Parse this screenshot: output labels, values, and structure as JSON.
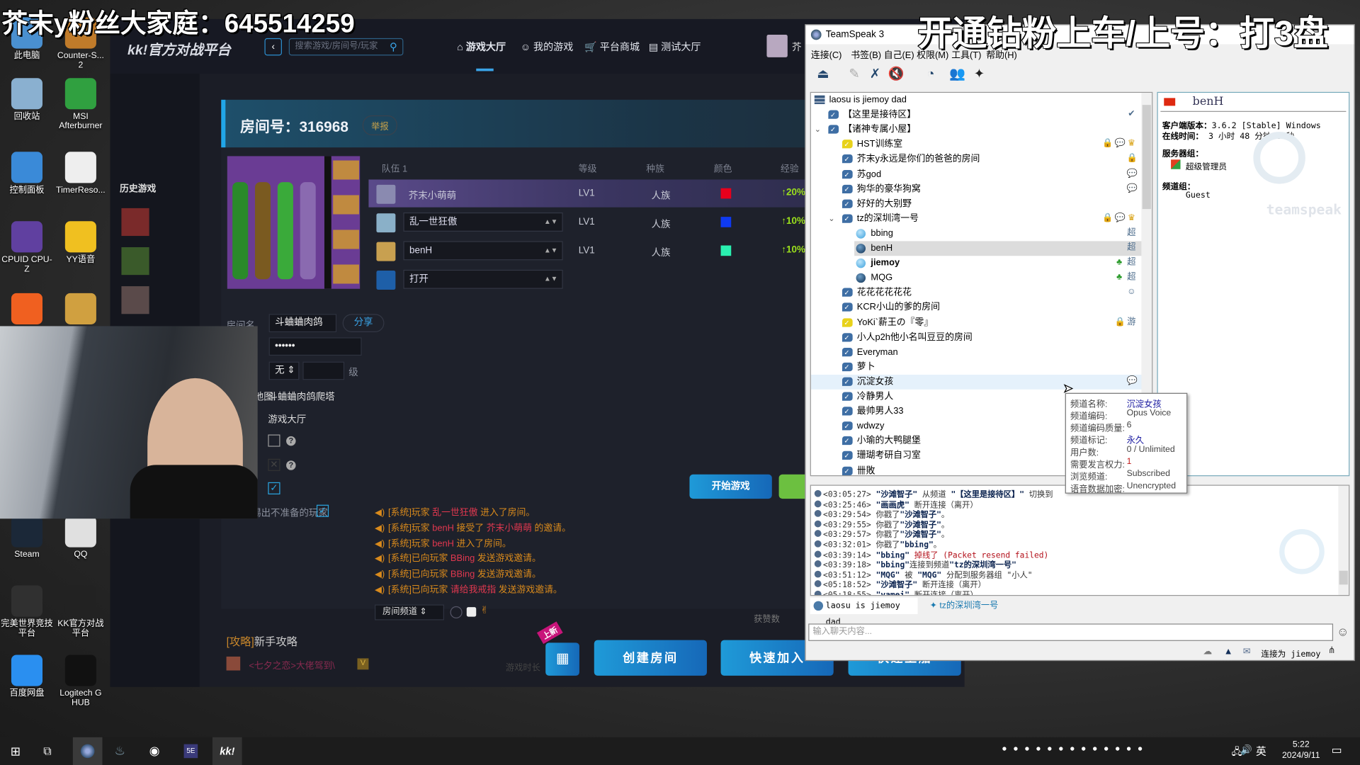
{
  "overlay": {
    "left_text": "芥末y粉丝大家庭：645514259",
    "right_text": "开通钻粉上车/上号：打3盘"
  },
  "desktop_icons": [
    {
      "label": "此电脑",
      "color": "#4a90d0"
    },
    {
      "label": "Counter-S... 2",
      "color": "#c07b2a"
    },
    {
      "label": "回收站",
      "color": "#8ab0d0"
    },
    {
      "label": "MSI Afterburner",
      "color": "#30a040"
    },
    {
      "label": "控制面板",
      "color": "#3a8ad8"
    },
    {
      "label": "TimerReso...",
      "color": "#eeeeee"
    },
    {
      "label": "CPUID CPU-Z",
      "color": "#6040a0"
    },
    {
      "label": "YY语音",
      "color": "#f0c020"
    },
    {
      "label": "",
      "color": "#f06020"
    },
    {
      "label": "",
      "color": "#d0a040"
    },
    {
      "label": "Steam",
      "color": "#1b2838"
    },
    {
      "label": "QQ",
      "color": "#e0e0e0"
    },
    {
      "label": "完美世界竞技平台",
      "color": "#303030"
    },
    {
      "label": "KK官方对战平台",
      "color": "#222222"
    },
    {
      "label": "百度网盘",
      "color": "#2a8ff0"
    },
    {
      "label": "Logitech G HUB",
      "color": "#111111"
    }
  ],
  "kk": {
    "logo": "kk!官方对战平台",
    "search_placeholder": "搜索游戏/房间号/玩家",
    "nav": [
      {
        "label": "游戏大厅",
        "active": true
      },
      {
        "label": "我的游戏"
      },
      {
        "label": "平台商城"
      },
      {
        "label": "测试大厅"
      }
    ],
    "user_name": "芥",
    "sidebar_title": "历史游戏",
    "room": {
      "title": "房间号：316968",
      "report": "举报",
      "team_header": "队伍 1",
      "col_level": "等级",
      "col_race": "种族",
      "col_color": "颜色",
      "col_exp": "经验",
      "players": [
        {
          "name": "芥末小萌萌",
          "level": "LV1",
          "race": "人族",
          "color": "#e8001c",
          "exp": "↑20%",
          "selected": true,
          "avatar": "#8a8ab0"
        },
        {
          "name": "乱一世狂傲",
          "level": "LV1",
          "race": "人族",
          "color": "#0f3af0",
          "exp": "↑10%",
          "avatar": "#8ab0c8"
        },
        {
          "name": "benH",
          "level": "LV1",
          "race": "人族",
          "color": "#2af0b0",
          "exp": "↑10%",
          "avatar": "#c8a050"
        },
        {
          "name": "打开",
          "avatar": "#1e5fa8"
        }
      ],
      "form": {
        "room_name_label": "房间名",
        "room_name": "斗蛐蛐肉鸽",
        "share": "分享",
        "password_label": "密 码",
        "password": "••••••",
        "level_label": "等级",
        "level_value": "无",
        "level_unit": "级",
        "map_label": "地图:",
        "map": "斗蛐蛐肉鸽爬塔",
        "lobby": "游戏大厅",
        "kick_label": "踢出不准备的玩家"
      },
      "start_game": "开始游戏",
      "messages": [
        [
          {
            "t": "[系统]玩家 "
          },
          {
            "t": "乱一世狂傲",
            "hl": true
          },
          {
            "t": " 进入了房间。"
          }
        ],
        [
          {
            "t": "[系统]玩家 "
          },
          {
            "t": "benH",
            "hl": true
          },
          {
            "t": " 接受了 "
          },
          {
            "t": "芥末小萌萌",
            "hl": true
          },
          {
            "t": " 的邀请。"
          }
        ],
        [
          {
            "t": "[系统]玩家 "
          },
          {
            "t": "benH",
            "hl": true
          },
          {
            "t": " 进入了房间。"
          }
        ],
        [
          {
            "t": "[系统]已向玩家 "
          },
          {
            "t": "BBing",
            "hl": true
          },
          {
            "t": " 发送游戏邀请。"
          }
        ],
        [
          {
            "t": "[系统]已向玩家 "
          },
          {
            "t": "BBing",
            "hl": true
          },
          {
            "t": " 发送游戏邀请。"
          }
        ],
        [
          {
            "t": "[系统]已向玩家 "
          },
          {
            "t": "请给我戒指",
            "hl": true
          },
          {
            "t": " 发送游戏邀请。"
          }
        ]
      ],
      "chat_channel": "房间频道"
    },
    "guide_tag": "[攻略]",
    "guide_title": "新手攻略",
    "featured_user": "<七夕之恋>大佬驾到\\",
    "featured_meta": "游戏时长",
    "likes_label": "获赞数",
    "new_badge": "上新",
    "create_room": "创建房间",
    "quick_join": "快速加入",
    "third_button": "快速上船"
  },
  "teamspeak": {
    "title": "TeamSpeak 3",
    "menu": [
      "连接(C)",
      "书签(B)",
      "自己(E)",
      "权限(M)",
      "工具(T)",
      "帮助(H)"
    ],
    "tree": [
      {
        "label": "laosu is jiemoy dad",
        "type": "server",
        "level": 0
      },
      {
        "label": "【这里是接待区】",
        "type": "channel",
        "level": 1,
        "icons": [
          "✔"
        ]
      },
      {
        "label": "【诸神专属小屋】",
        "type": "channel",
        "level": 1,
        "expanded": true
      },
      {
        "label": "HST训练室",
        "type": "channel",
        "level": 2,
        "yellow": true,
        "icons": [
          "🔒",
          "💬",
          "♛"
        ]
      },
      {
        "label": "芥末y永远是你们的爸爸的房间",
        "type": "channel",
        "level": 2,
        "icons": [
          "🔒"
        ]
      },
      {
        "label": "苏god",
        "type": "channel",
        "level": 2,
        "icons": [
          "💬"
        ]
      },
      {
        "label": "狗华的豪华狗窝",
        "type": "channel",
        "level": 2,
        "icons": [
          "💬"
        ]
      },
      {
        "label": "好好的大别野",
        "type": "channel",
        "level": 2
      },
      {
        "label": "tz的深圳湾一号",
        "type": "channel",
        "level": 2,
        "expanded": true,
        "icons": [
          "🔒",
          "💬",
          "♛"
        ]
      },
      {
        "label": "bbing",
        "type": "client",
        "level": 3,
        "tone": "light",
        "icons": [
          "超"
        ]
      },
      {
        "label": "benH",
        "type": "client",
        "level": 3,
        "tone": "dark",
        "selected": true,
        "icons": [
          "超"
        ]
      },
      {
        "label": "jiemoy",
        "type": "client",
        "level": 3,
        "tone": "light",
        "bold": true,
        "icons": [
          "♣",
          "超"
        ]
      },
      {
        "label": "MQG",
        "type": "client",
        "level": 3,
        "tone": "dark",
        "icons": [
          "♣",
          "超"
        ]
      },
      {
        "label": "花花花花花花",
        "type": "channel",
        "level": 2,
        "icons": [
          "☺"
        ]
      },
      {
        "label": "KCR小山的爹的房间",
        "type": "channel",
        "level": 2
      },
      {
        "label": "YoKi`薪王の『零』",
        "type": "channel",
        "level": 2,
        "yellow": true,
        "icons": [
          "🔒",
          "游"
        ]
      },
      {
        "label": "小人p2h他小名叫豆豆的房间",
        "type": "channel",
        "level": 2
      },
      {
        "label": "Everyman",
        "type": "channel",
        "level": 2
      },
      {
        "label": "萝卜",
        "type": "channel",
        "level": 2
      },
      {
        "label": "沉淀女孩",
        "type": "channel",
        "level": 2,
        "hover": true,
        "icons": [
          "💬"
        ]
      },
      {
        "label": "冷静男人",
        "type": "channel",
        "level": 2
      },
      {
        "label": "最帅男人33",
        "type": "channel",
        "level": 2
      },
      {
        "label": "wdwzy",
        "type": "channel",
        "level": 2
      },
      {
        "label": "小瑜的大鸭腿堡",
        "type": "channel",
        "level": 2
      },
      {
        "label": "珊瑚考研自习室",
        "type": "channel",
        "level": 2
      },
      {
        "label": "卌敗",
        "type": "channel",
        "level": 2
      }
    ],
    "info": {
      "name": "benH",
      "version_label": "客户端版本：",
      "version": "3.6.2 [Stable] Windows",
      "online_label": "在线时间：",
      "online": "3 小时 48 分钟 6 秒",
      "server_group_label": "服务器组：",
      "server_group": "超级管理员",
      "channel_group_label": "频道组：",
      "channel_group": "Guest",
      "watermark": "teamspeak"
    },
    "tooltip": [
      {
        "k": "频道名称:",
        "v": "沉淀女孩",
        "c": "#1a1aa0"
      },
      {
        "k": "频道编码:",
        "v": "Opus Voice"
      },
      {
        "k": "频道编码质量:",
        "v": "6"
      },
      {
        "k": "频道标记:",
        "v": "永久",
        "c": "#1a1aa0"
      },
      {
        "k": "用户数:",
        "v": "0 / Unlimited"
      },
      {
        "k": "需要发言权力:",
        "v": "1",
        "c": "#c01818"
      },
      {
        "k": "浏览频道:",
        "v": "Subscribed"
      },
      {
        "k": "语音数据加密:",
        "v": "Unencrypted"
      }
    ],
    "log": [
      {
        "time": "<03:05:27>",
        "parts": [
          {
            "t": "\"沙滩智子\"",
            "s": "nm"
          },
          {
            "t": " 从频道 "
          },
          {
            "t": "\"【这里是接待区】\"",
            "s": "nm"
          },
          {
            "t": " 切换到 "
          }
        ]
      },
      {
        "time": "<03:25:46>",
        "parts": [
          {
            "t": "\"画画虎\"",
            "s": "nm"
          },
          {
            "t": " 断开连接（离开）"
          }
        ]
      },
      {
        "time": "<03:29:54>",
        "parts": [
          {
            "t": "你戳了"
          },
          {
            "t": "\"沙滩智子\"",
            "s": "nm"
          },
          {
            "t": "。"
          }
        ]
      },
      {
        "time": "<03:29:55>",
        "parts": [
          {
            "t": "你戳了"
          },
          {
            "t": "\"沙滩智子\"",
            "s": "nm"
          },
          {
            "t": "。"
          }
        ]
      },
      {
        "time": "<03:29:57>",
        "parts": [
          {
            "t": "你戳了"
          },
          {
            "t": "\"沙滩智子\"",
            "s": "nm"
          },
          {
            "t": "。"
          }
        ]
      },
      {
        "time": "<03:32:01>",
        "parts": [
          {
            "t": "你戳了"
          },
          {
            "t": "\"bbing\"",
            "s": "nm"
          },
          {
            "t": "。"
          }
        ]
      },
      {
        "time": "<03:39:14>",
        "parts": [
          {
            "t": "\"bbing\"",
            "s": "nm"
          },
          {
            "t": " 掉线了 (Packet resend failed)",
            "s": "rd"
          }
        ]
      },
      {
        "time": "<03:39:18>",
        "parts": [
          {
            "t": "\"bbing\"",
            "s": "nm"
          },
          {
            "t": "连接到频道"
          },
          {
            "t": "\"tz的深圳湾一号\"",
            "s": "nm"
          }
        ]
      },
      {
        "time": "<03:51:12>",
        "parts": [
          {
            "t": "\"MQG\"",
            "s": "nm"
          },
          {
            "t": " 被 "
          },
          {
            "t": "\"MQG\"",
            "s": "nm"
          },
          {
            "t": " 分配到服务器组 \"小人\""
          }
        ]
      },
      {
        "time": "<05:18:52>",
        "parts": [
          {
            "t": "\"沙滩智子\"",
            "s": "nm"
          },
          {
            "t": " 断开连接（离开）"
          }
        ]
      },
      {
        "time": "<05:18:55>",
        "parts": [
          {
            "t": "\"vamei\"",
            "s": "nm"
          },
          {
            "t": " 断开连接（离开）"
          }
        ]
      }
    ],
    "tabs": [
      "laosu is jiemoy dad",
      "tz的深圳湾一号"
    ],
    "chat_placeholder": "输入聊天内容...",
    "status": "连接为 jiemoy"
  },
  "taskbar": {
    "time": "5:22",
    "date": "2024/9/11",
    "ime": "英",
    "kk_label": "kk!"
  }
}
